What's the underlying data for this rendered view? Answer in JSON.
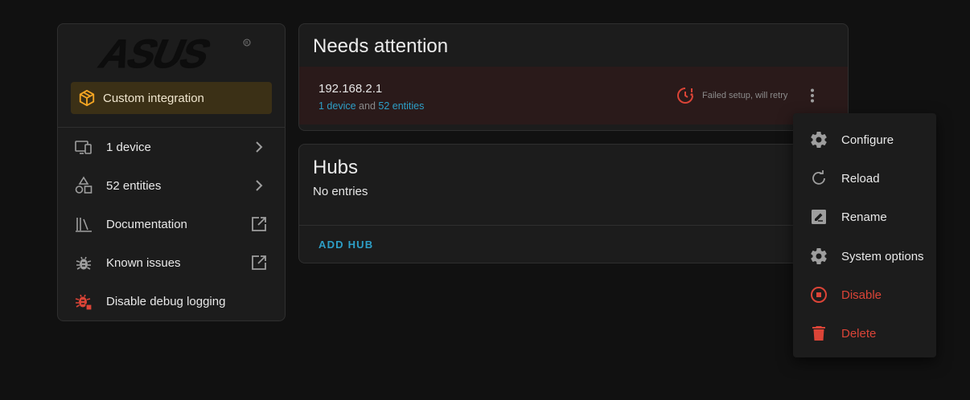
{
  "info_card": {
    "logo_text": "ASUS",
    "badge_label": "Custom integration",
    "rows": [
      {
        "label": "1 device"
      },
      {
        "label": "52 entities"
      },
      {
        "label": "Documentation"
      },
      {
        "label": "Known issues"
      },
      {
        "label": "Disable debug logging"
      }
    ]
  },
  "attention": {
    "title": "Needs attention",
    "entry": {
      "host": "192.168.2.1",
      "devices_link": "1 device",
      "and_text": " and ",
      "entities_link": "52 entities",
      "status": "Failed setup, will retry"
    }
  },
  "hubs": {
    "title": "Hubs",
    "empty_text": "No entries",
    "add_label": "ADD HUB"
  },
  "menu": {
    "items": [
      {
        "label": "Configure"
      },
      {
        "label": "Reload"
      },
      {
        "label": "Rename"
      },
      {
        "label": "System options"
      },
      {
        "label": "Disable"
      },
      {
        "label": "Delete"
      }
    ]
  },
  "colors": {
    "background": "#111111",
    "card": "#1c1c1c",
    "accent_link": "#2d9fc7",
    "error": "#db4437",
    "badge_bg": "#3b3016",
    "badge_icon": "#f5a623"
  }
}
